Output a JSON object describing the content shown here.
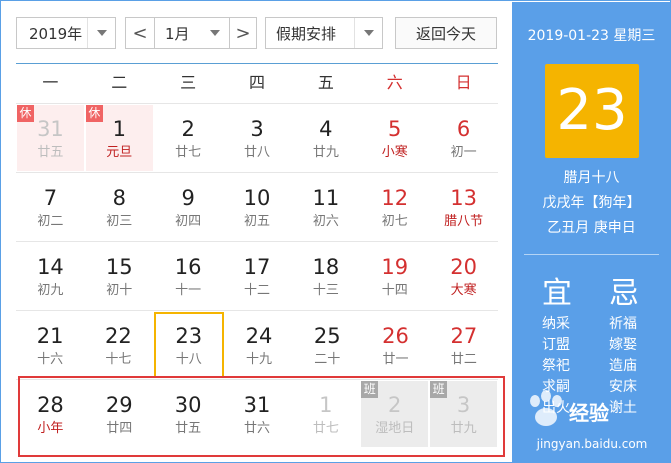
{
  "toolbar": {
    "year": "2019年",
    "prev": "<",
    "month": "1月",
    "next": ">",
    "holiday": "假期安排",
    "today_btn": "返回今天"
  },
  "weekdays": [
    "一",
    "二",
    "三",
    "四",
    "五",
    "六",
    "日"
  ],
  "weeks": [
    [
      {
        "d": "31",
        "l": "廿五",
        "badge": "休"
      },
      {
        "d": "1",
        "l": "元旦",
        "badge": "休"
      },
      {
        "d": "2",
        "l": "廿七"
      },
      {
        "d": "3",
        "l": "廿八"
      },
      {
        "d": "4",
        "l": "廿九"
      },
      {
        "d": "5",
        "l": "小寒"
      },
      {
        "d": "6",
        "l": "初一"
      }
    ],
    [
      {
        "d": "7",
        "l": "初二"
      },
      {
        "d": "8",
        "l": "初三"
      },
      {
        "d": "9",
        "l": "初四"
      },
      {
        "d": "10",
        "l": "初五"
      },
      {
        "d": "11",
        "l": "初六"
      },
      {
        "d": "12",
        "l": "初七"
      },
      {
        "d": "13",
        "l": "腊八节"
      }
    ],
    [
      {
        "d": "14",
        "l": "初九"
      },
      {
        "d": "15",
        "l": "初十"
      },
      {
        "d": "16",
        "l": "十一"
      },
      {
        "d": "17",
        "l": "十二"
      },
      {
        "d": "18",
        "l": "十三"
      },
      {
        "d": "19",
        "l": "十四"
      },
      {
        "d": "20",
        "l": "大寒"
      }
    ],
    [
      {
        "d": "21",
        "l": "十六"
      },
      {
        "d": "22",
        "l": "十七"
      },
      {
        "d": "23",
        "l": "十八"
      },
      {
        "d": "24",
        "l": "十九"
      },
      {
        "d": "25",
        "l": "二十"
      },
      {
        "d": "26",
        "l": "廿一"
      },
      {
        "d": "27",
        "l": "廿二"
      }
    ],
    [
      {
        "d": "28",
        "l": "小年"
      },
      {
        "d": "29",
        "l": "廿四"
      },
      {
        "d": "30",
        "l": "廿五"
      },
      {
        "d": "31",
        "l": "廿六"
      },
      {
        "d": "1",
        "l": "廿七"
      },
      {
        "d": "2",
        "l": "湿地日",
        "badge": "班"
      },
      {
        "d": "3",
        "l": "廿九",
        "badge": "班"
      }
    ]
  ],
  "side": {
    "date": "2019-01-23 星期三",
    "day": "23",
    "lunar": "腊月十八",
    "ganzhi_year": "戊戌年【狗年】",
    "ganzhi_day": "乙丑月 庚申日",
    "yi_title": "宜",
    "ji_title": "忌",
    "yi": [
      "纳采",
      "订盟",
      "祭祀",
      "求嗣",
      "出火"
    ],
    "ji": [
      "祈福",
      "嫁娶",
      "造庙",
      "安床",
      "谢土"
    ]
  },
  "watermark": {
    "brand": "经验",
    "url": "jingyan.baidu.com"
  },
  "colors": {
    "accent": "#5a9fe8",
    "today": "#f5b400",
    "holiday_red": "#d43030"
  }
}
